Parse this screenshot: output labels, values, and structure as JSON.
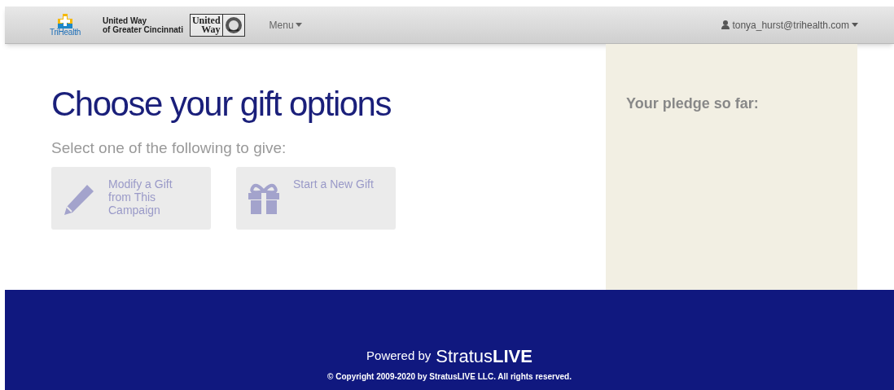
{
  "header": {
    "logo_1": "TriHealth",
    "logo_2_lines": [
      "United Way",
      "of Greater Cincinnati"
    ],
    "logo_3_lines": [
      "United",
      "Way"
    ],
    "menu": "Menu",
    "user": "tonya_hurst@trihealth.com"
  },
  "main": {
    "title": "Choose your gift options",
    "subtitle": "Select one of the following to give:",
    "options": [
      {
        "kind": "modify",
        "label": "Modify a Gift from This Campaign"
      },
      {
        "kind": "new",
        "label": "Start a New Gift"
      }
    ]
  },
  "sidebar": {
    "title": "Your pledge so far:"
  },
  "footer": {
    "powered_by": "Powered by",
    "brand_light": "Stratus",
    "brand_bold": "LIVE",
    "copyright": "© Copyright 2009-2020 by StratusLIVE LLC. All rights reserved."
  }
}
